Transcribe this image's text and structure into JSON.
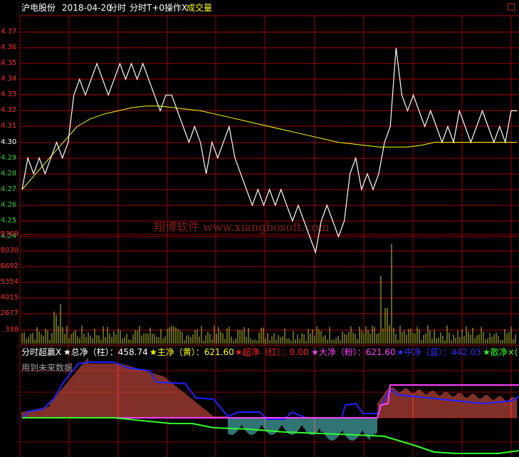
{
  "header": {
    "stock_name": "沪电股份",
    "date": "2018-04-20",
    "mode": "分时",
    "indicator": "分时T+0操作X",
    "sub_indicator": "成交量",
    "window_button": "□"
  },
  "panel2": {
    "title": "分时超赢X",
    "items": [
      {
        "label": "★总净（柱）：458.74",
        "color": "#ffffff"
      },
      {
        "label": "★主净（黄）：621.60",
        "color": "#ffff00"
      },
      {
        "label": "★超净（红）：0.00",
        "color": "#ff2020"
      },
      {
        "label": "★大净（粉）：621.60",
        "color": "#ff40ff"
      },
      {
        "label": "★中净（蓝）：442.03",
        "color": "#3030ff"
      },
      {
        "label": "★散净×(",
        "color": "#30ff30"
      }
    ],
    "note": "用到未来数据"
  },
  "watermark": "翔博软件 www.xiangbosoft.com",
  "colors": {
    "grid": "#a00000",
    "price_line": "#ffffff",
    "avg_line": "#ffff00",
    "volume_bar": "#c8c830",
    "pos_bar": "#ff6050",
    "neg_bar": "#60e8e8",
    "blue_line": "#2020ff",
    "pink_line": "#ff40ff",
    "green_line": "#30ff30"
  },
  "chart_data": [
    {
      "type": "line",
      "name": "price",
      "y_ticks": [
        "4.37",
        "4.36",
        "4.35",
        "4.34",
        "4.33",
        "4.32",
        "4.31",
        "4.30",
        "4.29",
        "4.28",
        "4.27",
        "4.26",
        "4.25",
        "4.24"
      ],
      "ylim": [
        4.24,
        4.37
      ],
      "price": [
        4.27,
        4.29,
        4.28,
        4.29,
        4.28,
        4.29,
        4.3,
        4.29,
        4.3,
        4.33,
        4.34,
        4.33,
        4.34,
        4.35,
        4.34,
        4.33,
        4.34,
        4.35,
        4.34,
        4.35,
        4.34,
        4.35,
        4.34,
        4.33,
        4.32,
        4.33,
        4.33,
        4.32,
        4.31,
        4.3,
        4.31,
        4.3,
        4.28,
        4.3,
        4.29,
        4.3,
        4.31,
        4.29,
        4.28,
        4.27,
        4.26,
        4.27,
        4.26,
        4.27,
        4.26,
        4.27,
        4.26,
        4.25,
        4.26,
        4.25,
        4.24,
        4.23,
        4.25,
        4.26,
        4.25,
        4.24,
        4.25,
        4.28,
        4.29,
        4.27,
        4.28,
        4.27,
        4.28,
        4.3,
        4.31,
        4.36,
        4.33,
        4.32,
        4.33,
        4.32,
        4.31,
        4.32,
        4.31,
        4.3,
        4.31,
        4.3,
        4.32,
        4.31,
        4.3,
        4.31,
        4.32,
        4.31,
        4.3,
        4.31,
        4.3,
        4.32,
        4.32
      ],
      "avg": [
        4.27,
        4.28,
        4.29,
        4.3,
        4.31,
        4.315,
        4.318,
        4.32,
        4.322,
        4.323,
        4.323,
        4.322,
        4.321,
        4.32,
        4.318,
        4.316,
        4.314,
        4.312,
        4.31,
        4.308,
        4.306,
        4.304,
        4.302,
        4.3,
        4.299,
        4.298,
        4.297,
        4.297,
        4.297,
        4.298,
        4.3,
        4.3,
        4.3,
        4.3,
        4.3,
        4.3,
        4.3
      ]
    },
    {
      "type": "bar",
      "name": "volume",
      "y_ticks": [
        "9369",
        "8030",
        "6692",
        "5354",
        "4015",
        "2677",
        "338"
      ]
    },
    {
      "type": "bar",
      "name": "分时超赢X"
    }
  ]
}
